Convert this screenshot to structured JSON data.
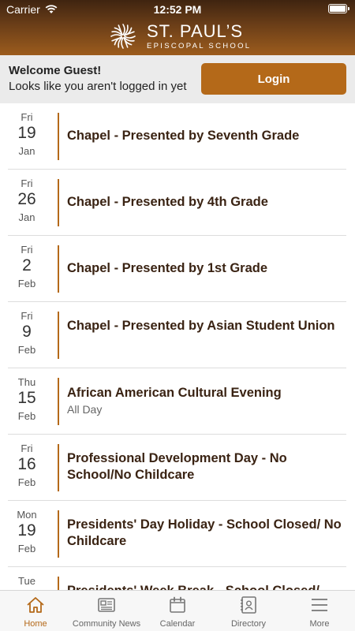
{
  "status": {
    "carrier": "Carrier",
    "time": "12:52 PM"
  },
  "brand": {
    "name": "ST. PAUL’S",
    "subtitle": "EPISCOPAL SCHOOL"
  },
  "welcome": {
    "title": "Welcome Guest!",
    "subtitle": "Looks like you aren't logged in yet",
    "login_label": "Login"
  },
  "events": [
    {
      "dow": "Fri",
      "day": "19",
      "month": "Jan",
      "title": "Chapel - Presented by Seventh Grade",
      "sub": ""
    },
    {
      "dow": "Fri",
      "day": "26",
      "month": "Jan",
      "title": "Chapel - Presented by 4th Grade",
      "sub": ""
    },
    {
      "dow": "Fri",
      "day": "2",
      "month": "Feb",
      "title": "Chapel - Presented by 1st Grade",
      "sub": ""
    },
    {
      "dow": "Fri",
      "day": "9",
      "month": "Feb",
      "title": "Chapel - Presented by Asian Student Union",
      "sub": ""
    },
    {
      "dow": "Thu",
      "day": "15",
      "month": "Feb",
      "title": "African American Cultural Evening",
      "sub": "All Day"
    },
    {
      "dow": "Fri",
      "day": "16",
      "month": "Feb",
      "title": "Professional Development Day - No School/No Childcare",
      "sub": ""
    },
    {
      "dow": "Mon",
      "day": "19",
      "month": "Feb",
      "title": "Presidents' Day Holiday - School Closed/ No Childcare",
      "sub": ""
    },
    {
      "dow": "Tue",
      "day": "",
      "month": "",
      "title": "Presidents' Week Break - School Closed/",
      "sub": ""
    }
  ],
  "tabs": [
    {
      "label": "Home",
      "icon": "home-icon",
      "active": true
    },
    {
      "label": "Community News",
      "icon": "news-icon",
      "active": false
    },
    {
      "label": "Calendar",
      "icon": "calendar-icon",
      "active": false
    },
    {
      "label": "Directory",
      "icon": "directory-icon",
      "active": false
    },
    {
      "label": "More",
      "icon": "menu-icon",
      "active": false
    }
  ],
  "colors": {
    "accent": "#b46919",
    "header_dark": "#3f2410",
    "header_light": "#9c5c1d"
  }
}
